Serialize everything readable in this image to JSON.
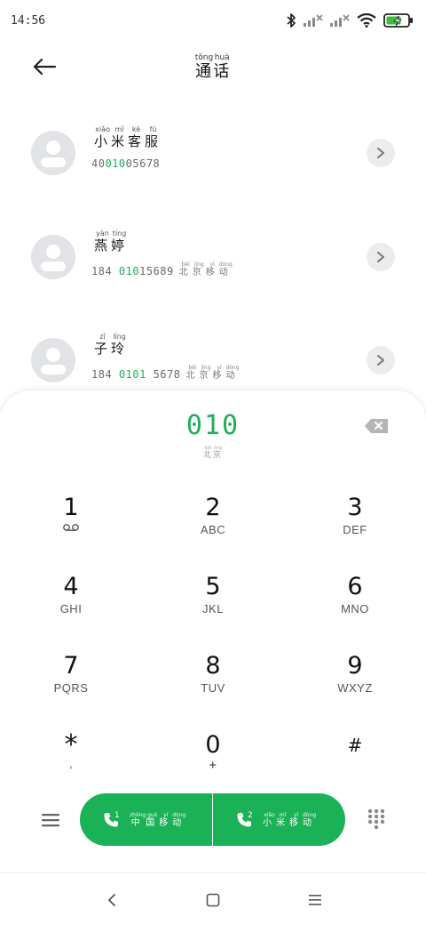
{
  "status_bar": {
    "time": "14:56",
    "icons": [
      "bluetooth-icon",
      "signal-sim1-icon",
      "signal-sim2-icon",
      "wifi-icon",
      "battery-charging-icon"
    ]
  },
  "header": {
    "back_icon": "arrow-left-icon",
    "title": [
      {
        "char": "通",
        "pinyin": "tōng"
      },
      {
        "char": "话",
        "pinyin": "huà"
      }
    ]
  },
  "contacts": [
    {
      "name": [
        {
          "char": "小",
          "pinyin": "xiǎo"
        },
        {
          "char": "米",
          "pinyin": "mǐ"
        },
        {
          "char": "客",
          "pinyin": "kè"
        },
        {
          "char": "服",
          "pinyin": "fú"
        }
      ],
      "number_pre": "40",
      "number_match": "010",
      "number_post": "05678",
      "location": []
    },
    {
      "name": [
        {
          "char": "燕",
          "pinyin": "yàn"
        },
        {
          "char": "婷",
          "pinyin": "tíng"
        }
      ],
      "number_pre": "184 ",
      "number_match": "010",
      "number_post": "15689",
      "location": [
        {
          "char": "北",
          "pinyin": "běi"
        },
        {
          "char": "京",
          "pinyin": "jīng"
        },
        {
          "char": "移",
          "pinyin": "yí"
        },
        {
          "char": "动",
          "pinyin": "dòng"
        }
      ]
    },
    {
      "name": [
        {
          "char": "子",
          "pinyin": "zǐ"
        },
        {
          "char": "玲",
          "pinyin": "líng"
        }
      ],
      "number_pre": "184 ",
      "number_match": "0101",
      "number_post": " 5678",
      "location": [
        {
          "char": "北",
          "pinyin": "běi"
        },
        {
          "char": "京",
          "pinyin": "jīng"
        },
        {
          "char": "移",
          "pinyin": "yí"
        },
        {
          "char": "动",
          "pinyin": "dòng"
        }
      ]
    }
  ],
  "dialer": {
    "display": "010",
    "location": [
      {
        "char": "北",
        "pinyin": "běi"
      },
      {
        "char": "京",
        "pinyin": "jīng"
      }
    ],
    "keys": [
      {
        "digit": "1",
        "sub": "",
        "icon": "voicemail-icon"
      },
      {
        "digit": "2",
        "sub": "ABC"
      },
      {
        "digit": "3",
        "sub": "DEF"
      },
      {
        "digit": "4",
        "sub": "GHI"
      },
      {
        "digit": "5",
        "sub": "JKL"
      },
      {
        "digit": "6",
        "sub": "MNO"
      },
      {
        "digit": "7",
        "sub": "PQRS"
      },
      {
        "digit": "8",
        "sub": "TUV"
      },
      {
        "digit": "9",
        "sub": "WXYZ"
      },
      {
        "digit": "*",
        "sub": ","
      },
      {
        "digit": "0",
        "sub": "+"
      },
      {
        "digit": "#",
        "sub": ""
      }
    ],
    "call_buttons": [
      {
        "sim": "1",
        "carrier": [
          {
            "char": "中",
            "pinyin": "zhōng"
          },
          {
            "char": "国",
            "pinyin": "guó"
          },
          {
            "char": "移",
            "pinyin": "yí"
          },
          {
            "char": "动",
            "pinyin": "dòng"
          }
        ]
      },
      {
        "sim": "2",
        "carrier": [
          {
            "char": "小",
            "pinyin": "xiǎo"
          },
          {
            "char": "米",
            "pinyin": "mǐ"
          },
          {
            "char": "移",
            "pinyin": "yí"
          },
          {
            "char": "动",
            "pinyin": "dòng"
          }
        ]
      }
    ],
    "accent_color": "#1bb157"
  },
  "nav_bar": {
    "icons": [
      "nav-back-icon",
      "nav-home-icon",
      "nav-recents-icon"
    ]
  }
}
